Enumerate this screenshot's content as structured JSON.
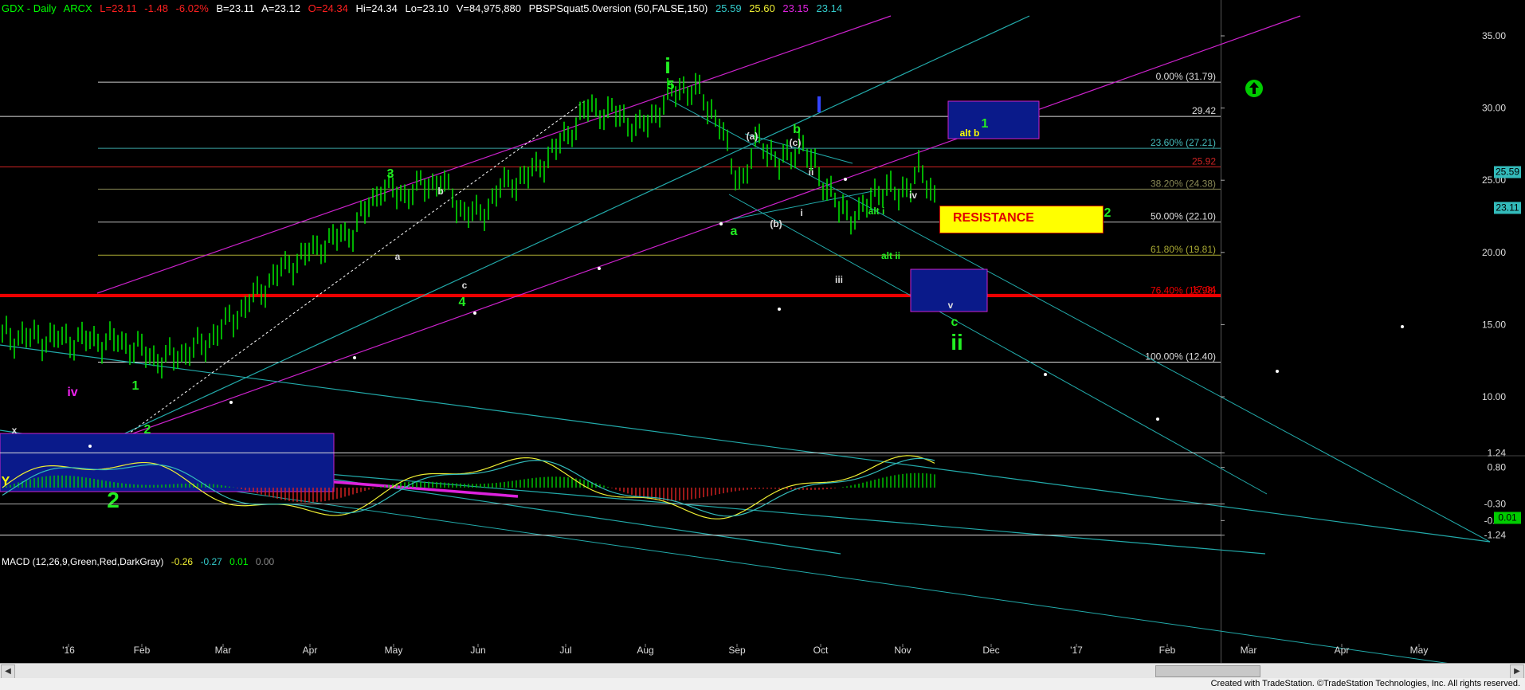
{
  "header": {
    "symbol": "GDX - Daily",
    "exchange": "ARCX",
    "last": "L=23.11",
    "change": "-1.48",
    "change_pct": "-6.02%",
    "bid": "B=23.11",
    "ask": "A=23.12",
    "open": "O=24.34",
    "high": "Hi=24.34",
    "low": "Lo=23.10",
    "volume": "V=84,975,880",
    "indicator": "PBSPSquat5.0version (50,FALSE,150)",
    "ind_v1": "25.59",
    "ind_v2": "25.60",
    "ind_v3": "23.15",
    "ind_v4": "23.14"
  },
  "macd_header": {
    "name": "MACD (12,26,9,Green,Red,DarkGray)",
    "v1": "-0.26",
    "v2": "-0.27",
    "v3": "0.01",
    "v4": "0.00"
  },
  "resistance_label": "RESISTANCE",
  "footer": "Created with TradeStation. ©TradeStation Technologies, Inc. All rights reserved.",
  "colors": {
    "green": "#00dd00",
    "red": "#ee0000",
    "cyan": "#33bbbb",
    "magenta": "#dd22dd",
    "white": "#ffffff",
    "yellow": "#ffff00",
    "navy": "#000088",
    "header_green": "#00ff00",
    "header_red": "#ff2020"
  },
  "chart_data": {
    "type": "candlestick",
    "symbol": "GDX",
    "y_axis": {
      "ticks": [
        "35.00",
        "30.00",
        "25.00",
        "20.00",
        "15.00",
        "10.00"
      ],
      "range": [
        7.2,
        37
      ]
    },
    "x_axis_labels": [
      "'16",
      "Feb",
      "Mar",
      "Apr",
      "May",
      "Jun",
      "Jul",
      "Aug",
      "Sep",
      "Oct",
      "Nov",
      "Dec",
      "'17",
      "Feb",
      "Mar",
      "Apr",
      "May"
    ],
    "price_series_approx": [
      [
        0,
        14.2
      ],
      [
        15,
        14.0
      ],
      [
        30,
        13.8
      ],
      [
        40,
        12.5
      ],
      [
        50,
        13.5
      ],
      [
        60,
        16.0
      ],
      [
        70,
        18.8
      ],
      [
        80,
        20.5
      ],
      [
        88,
        21.5
      ],
      [
        95,
        24.5
      ],
      [
        100,
        24.0
      ],
      [
        110,
        25.0
      ],
      [
        115,
        23.0
      ],
      [
        120,
        22.5
      ],
      [
        125,
        24.5
      ],
      [
        133,
        25.5
      ],
      [
        140,
        27.5
      ],
      [
        147,
        30.0
      ],
      [
        155,
        29.5
      ],
      [
        160,
        28.5
      ],
      [
        165,
        30.0
      ],
      [
        170,
        31.5
      ],
      [
        175,
        31.0
      ],
      [
        180,
        29.0
      ],
      [
        183,
        26.0
      ],
      [
        186,
        25.0
      ],
      [
        190,
        28.0
      ],
      [
        195,
        26.0
      ],
      [
        200,
        27.5
      ],
      [
        205,
        25.5
      ],
      [
        210,
        23.0
      ],
      [
        215,
        22.5
      ],
      [
        220,
        24.5
      ],
      [
        225,
        24.0
      ],
      [
        230,
        25.5
      ],
      [
        233,
        24.5
      ],
      [
        235,
        23.11
      ]
    ],
    "fib_levels": [
      {
        "label": "0.00% (31.79)",
        "value": 31.79
      },
      {
        "label": "29.42",
        "value": 29.42
      },
      {
        "label": "23.60% (27.21)",
        "value": 27.21
      },
      {
        "label": "25.92",
        "value": 25.92
      },
      {
        "label": "38.20% (24.38)",
        "value": 24.38
      },
      {
        "label": "50.00% (22.10)",
        "value": 22.1
      },
      {
        "label": "61.80% (19.81)",
        "value": 19.81
      },
      {
        "label": "17.04",
        "value": 17.04
      },
      {
        "label": "76.40% (16.98)",
        "value": 16.98
      },
      {
        "label": "100.00% (12.40)",
        "value": 12.4
      }
    ],
    "price_tags": [
      {
        "label": "25.59",
        "value": 25.59
      },
      {
        "label": "23.11",
        "value": 23.11
      }
    ],
    "wave_labels": [
      {
        "text": "i",
        "date": "2016-08-01",
        "price": 34.0,
        "color": "green",
        "size": "big"
      },
      {
        "text": "5",
        "date": "2016-08-05",
        "price": 32.3,
        "color": "green",
        "size": "small"
      },
      {
        "text": "3",
        "date": "2016-05-01",
        "price": 27.5,
        "color": "green",
        "size": "small"
      },
      {
        "text": "4",
        "date": "2016-05-27",
        "price": 20.0,
        "color": "green",
        "size": "small"
      },
      {
        "text": "1",
        "date": "2016-01-28",
        "price": 15.7,
        "color": "green",
        "size": "small"
      },
      {
        "text": "2",
        "date": "2016-02-01",
        "price": 13.3,
        "color": "green",
        "size": "small"
      },
      {
        "text": "2",
        "date": "2016-01-23",
        "price": 9.5,
        "color": "green",
        "size": "big"
      },
      {
        "text": "b",
        "date": "2016-09-26",
        "price": 30.0,
        "color": "green",
        "size": "small"
      },
      {
        "text": "a",
        "date": "2016-09-02",
        "price": 24.0,
        "color": "green",
        "size": "small"
      },
      {
        "text": "1",
        "date": "2016-11-23",
        "price": 30.5,
        "color": "green",
        "size": "small"
      },
      {
        "text": "2",
        "date": "2016-12-26",
        "price": 25.5,
        "color": "green",
        "size": "small"
      },
      {
        "text": "c",
        "date": "2016-11-10",
        "price": 19.0,
        "color": "green",
        "size": "small"
      },
      {
        "text": "ii",
        "date": "2016-11-13",
        "price": 17.5,
        "color": "green",
        "size": "big"
      },
      {
        "text": "alt i",
        "date": "2016-10-16",
        "price": 25.7,
        "color": "green",
        "size": "tiny"
      },
      {
        "text": "alt ii",
        "date": "2016-10-21",
        "price": 23.0,
        "color": "green",
        "size": "tiny"
      },
      {
        "text": "b",
        "date": "2016-05-16",
        "price": 27.6,
        "color": "white",
        "size": "tiny"
      },
      {
        "text": "a",
        "date": "2016-05-01",
        "price": 23.0,
        "color": "white",
        "size": "tiny"
      },
      {
        "text": "c",
        "date": "2016-05-25",
        "price": 21.0,
        "color": "white",
        "size": "tiny"
      },
      {
        "text": "(a)",
        "date": "2016-09-08",
        "price": 30.0,
        "color": "white",
        "size": "tiny"
      },
      {
        "text": "(c)",
        "date": "2016-09-25",
        "price": 29.3,
        "color": "white",
        "size": "tiny"
      },
      {
        "text": "(b)",
        "date": "2016-09-16",
        "price": 24.6,
        "color": "white",
        "size": "tiny"
      },
      {
        "text": "ii",
        "date": "2016-09-29",
        "price": 27.6,
        "color": "white",
        "size": "tiny"
      },
      {
        "text": "i",
        "date": "2016-09-22",
        "price": 25.3,
        "color": "white",
        "size": "tiny"
      },
      {
        "text": "iii",
        "date": "2016-10-13",
        "price": 21.4,
        "color": "white",
        "size": "tiny"
      },
      {
        "text": "iv",
        "date": "2016-11-01",
        "price": 26.5,
        "color": "white",
        "size": "tiny"
      },
      {
        "text": "v",
        "date": "2016-11-10",
        "price": 20.0,
        "color": "white",
        "size": "tiny"
      },
      {
        "text": "x",
        "date": "2016-01-04",
        "price": 13.0,
        "color": "white",
        "size": "tiny"
      },
      {
        "text": "alt b",
        "date": "2016-11-20",
        "price": 30.0,
        "color": "yellow",
        "size": "tiny"
      },
      {
        "text": "iv",
        "date": "2015-12-25",
        "price": 16.6,
        "color": "magenta",
        "size": "small"
      },
      {
        "text": "Y",
        "date": "2015-12-14",
        "price": 10.5,
        "color": "yellow",
        "size": "small"
      }
    ],
    "macd": {
      "header": "MACD (12,26,9,Green,Red,DarkGray)",
      "values": {
        "macd": -0.26,
        "signal": -0.27,
        "hist": 0.01,
        "zero": 0.0
      },
      "y_ticks": [
        "1.24",
        "0.80",
        "-0.30",
        "-0.80",
        "-1.24"
      ],
      "price_tags": [
        "0.01"
      ],
      "range": [
        -1.6,
        1.5
      ]
    },
    "grid": false,
    "up_arrow_marker": {
      "date": "2017-02-15",
      "price": 33.8,
      "color": "green"
    }
  }
}
